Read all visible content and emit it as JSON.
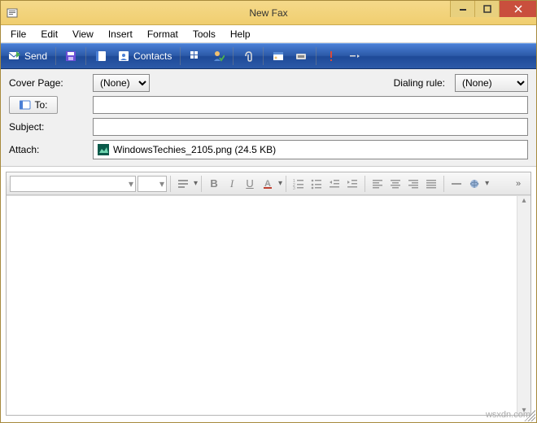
{
  "window": {
    "title": "New Fax"
  },
  "menus": [
    "File",
    "Edit",
    "View",
    "Insert",
    "Format",
    "Tools",
    "Help"
  ],
  "toolbar": {
    "send": "Send",
    "contacts": "Contacts"
  },
  "fields": {
    "cover_page_label": "Cover Page:",
    "cover_page_value": "(None)",
    "dialing_rule_label": "Dialing rule:",
    "dialing_rule_value": "(None)",
    "to_btn": "To:",
    "to_value": "",
    "subject_label": "Subject:",
    "subject_value": "",
    "attach_label": "Attach:",
    "attachment": "WindowsTechies_2105.png (24.5 KB)"
  },
  "editor": {
    "font_name": "",
    "font_size": "",
    "bold": "B",
    "italic": "I",
    "underline": "U"
  },
  "watermark": "wsxdn.com"
}
